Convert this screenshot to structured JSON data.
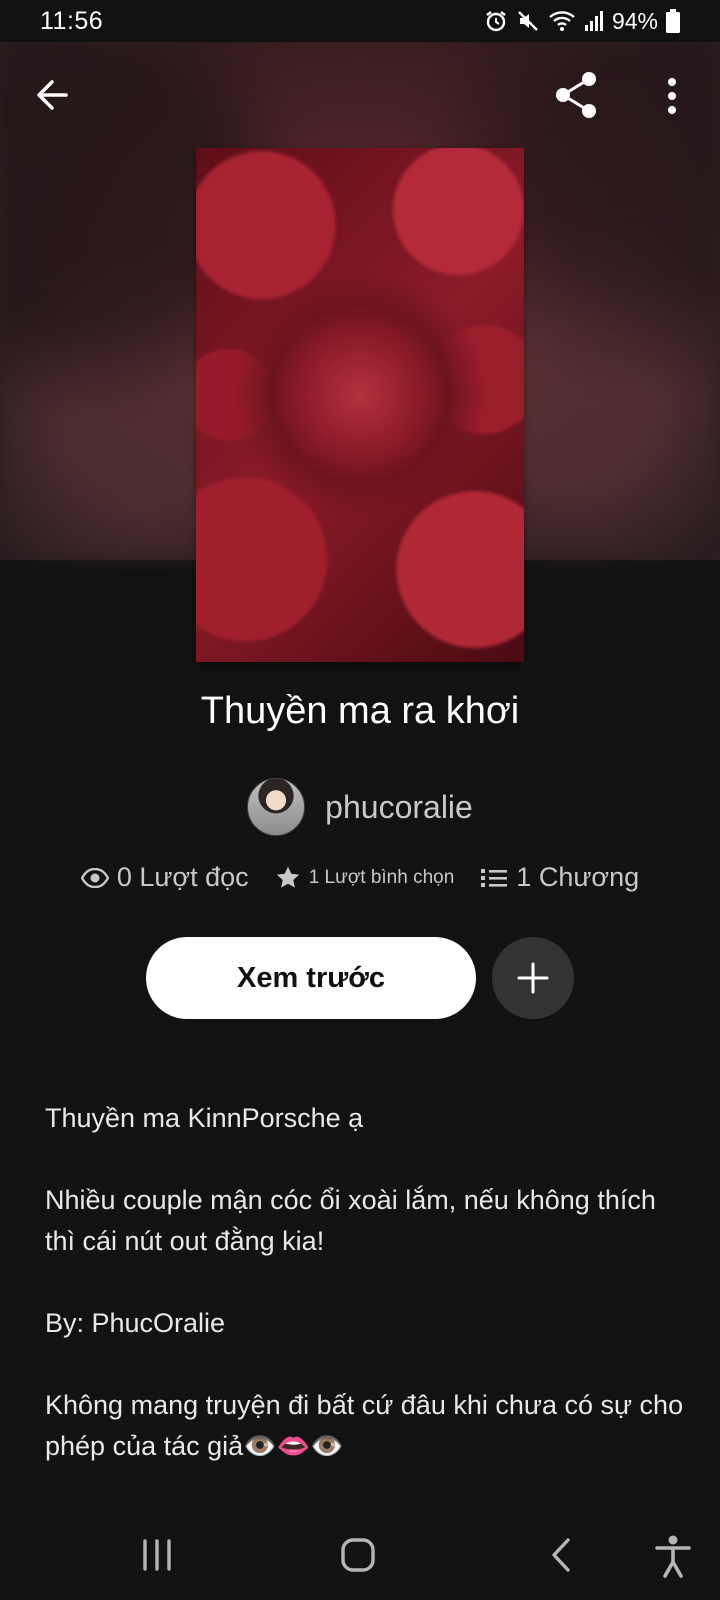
{
  "status_bar": {
    "time": "11:56",
    "battery": "94%"
  },
  "book": {
    "title": "Thuyền ma ra khơi",
    "author": "phucoralie",
    "stats": {
      "reads": "0 Lượt đọc",
      "votes": "1 Lượt bình chọn",
      "chapters": "1 Chương"
    },
    "preview_label": "Xem trước",
    "description": [
      "Thuyền ma KinnPorsche ạ",
      "Nhiều couple mận cóc ổi xoài lắm, nếu không thích thì cái nút out đằng kia!",
      "By: PhucOralie",
      "Không mang truyện đi bất cứ đâu khi chưa có sự cho phép của tác giả👁️👄👁️"
    ]
  },
  "colors": {
    "background": "#121212",
    "button_primary": "#ffffff",
    "button_secondary": "#333333"
  }
}
